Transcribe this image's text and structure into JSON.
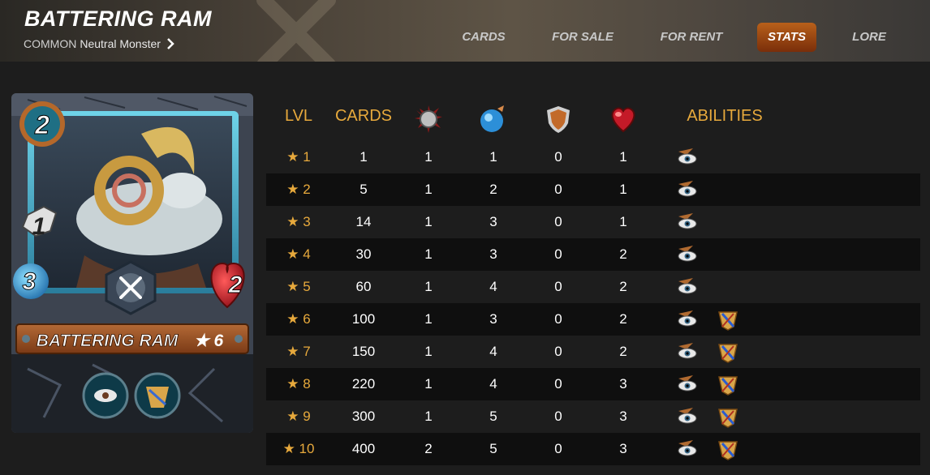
{
  "header": {
    "title": "BATTERING RAM",
    "rarity": "COMMON",
    "type": "Neutral Monster"
  },
  "tabs": [
    {
      "label": "CARDS",
      "active": false
    },
    {
      "label": "FOR SALE",
      "active": false
    },
    {
      "label": "FOR RENT",
      "active": false
    },
    {
      "label": "STATS",
      "active": true
    },
    {
      "label": "LORE",
      "active": false
    }
  ],
  "card": {
    "mana": "2",
    "attack": "1",
    "speed": "3",
    "health": "2",
    "name": "BATTERING RAM",
    "level": "★ 6",
    "attack_type_icon": "melee-swords-icon",
    "abilities_icons": [
      "true-strike-icon",
      "piercing-icon"
    ]
  },
  "stats": {
    "headers": {
      "lvl": "LVL",
      "cards": "CARDS",
      "attack_icon": "melee-attack-icon",
      "speed_icon": "speed-icon",
      "armor_icon": "armor-shield-icon",
      "health_icon": "health-heart-icon",
      "abilities": "ABILITIES"
    },
    "rows": [
      {
        "lvl": "★ 1",
        "cards": "1",
        "attack": "1",
        "speed": "1",
        "armor": "0",
        "health": "1",
        "abilities": [
          "true-strike-icon"
        ]
      },
      {
        "lvl": "★ 2",
        "cards": "5",
        "attack": "1",
        "speed": "2",
        "armor": "0",
        "health": "1",
        "abilities": [
          "true-strike-icon"
        ]
      },
      {
        "lvl": "★ 3",
        "cards": "14",
        "attack": "1",
        "speed": "3",
        "armor": "0",
        "health": "1",
        "abilities": [
          "true-strike-icon"
        ]
      },
      {
        "lvl": "★ 4",
        "cards": "30",
        "attack": "1",
        "speed": "3",
        "armor": "0",
        "health": "2",
        "abilities": [
          "true-strike-icon"
        ]
      },
      {
        "lvl": "★ 5",
        "cards": "60",
        "attack": "1",
        "speed": "4",
        "armor": "0",
        "health": "2",
        "abilities": [
          "true-strike-icon"
        ]
      },
      {
        "lvl": "★ 6",
        "cards": "100",
        "attack": "1",
        "speed": "3",
        "armor": "0",
        "health": "2",
        "abilities": [
          "true-strike-icon",
          "piercing-icon"
        ]
      },
      {
        "lvl": "★ 7",
        "cards": "150",
        "attack": "1",
        "speed": "4",
        "armor": "0",
        "health": "2",
        "abilities": [
          "true-strike-icon",
          "piercing-icon"
        ]
      },
      {
        "lvl": "★ 8",
        "cards": "220",
        "attack": "1",
        "speed": "4",
        "armor": "0",
        "health": "3",
        "abilities": [
          "true-strike-icon",
          "piercing-icon"
        ]
      },
      {
        "lvl": "★ 9",
        "cards": "300",
        "attack": "1",
        "speed": "5",
        "armor": "0",
        "health": "3",
        "abilities": [
          "true-strike-icon",
          "piercing-icon"
        ]
      },
      {
        "lvl": "★ 10",
        "cards": "400",
        "attack": "2",
        "speed": "5",
        "armor": "0",
        "health": "3",
        "abilities": [
          "true-strike-icon",
          "piercing-icon"
        ]
      }
    ]
  },
  "colors": {
    "accent": "#e7a93c",
    "active_tab": "#9a4412",
    "row_alt": "#0f0f0f"
  }
}
